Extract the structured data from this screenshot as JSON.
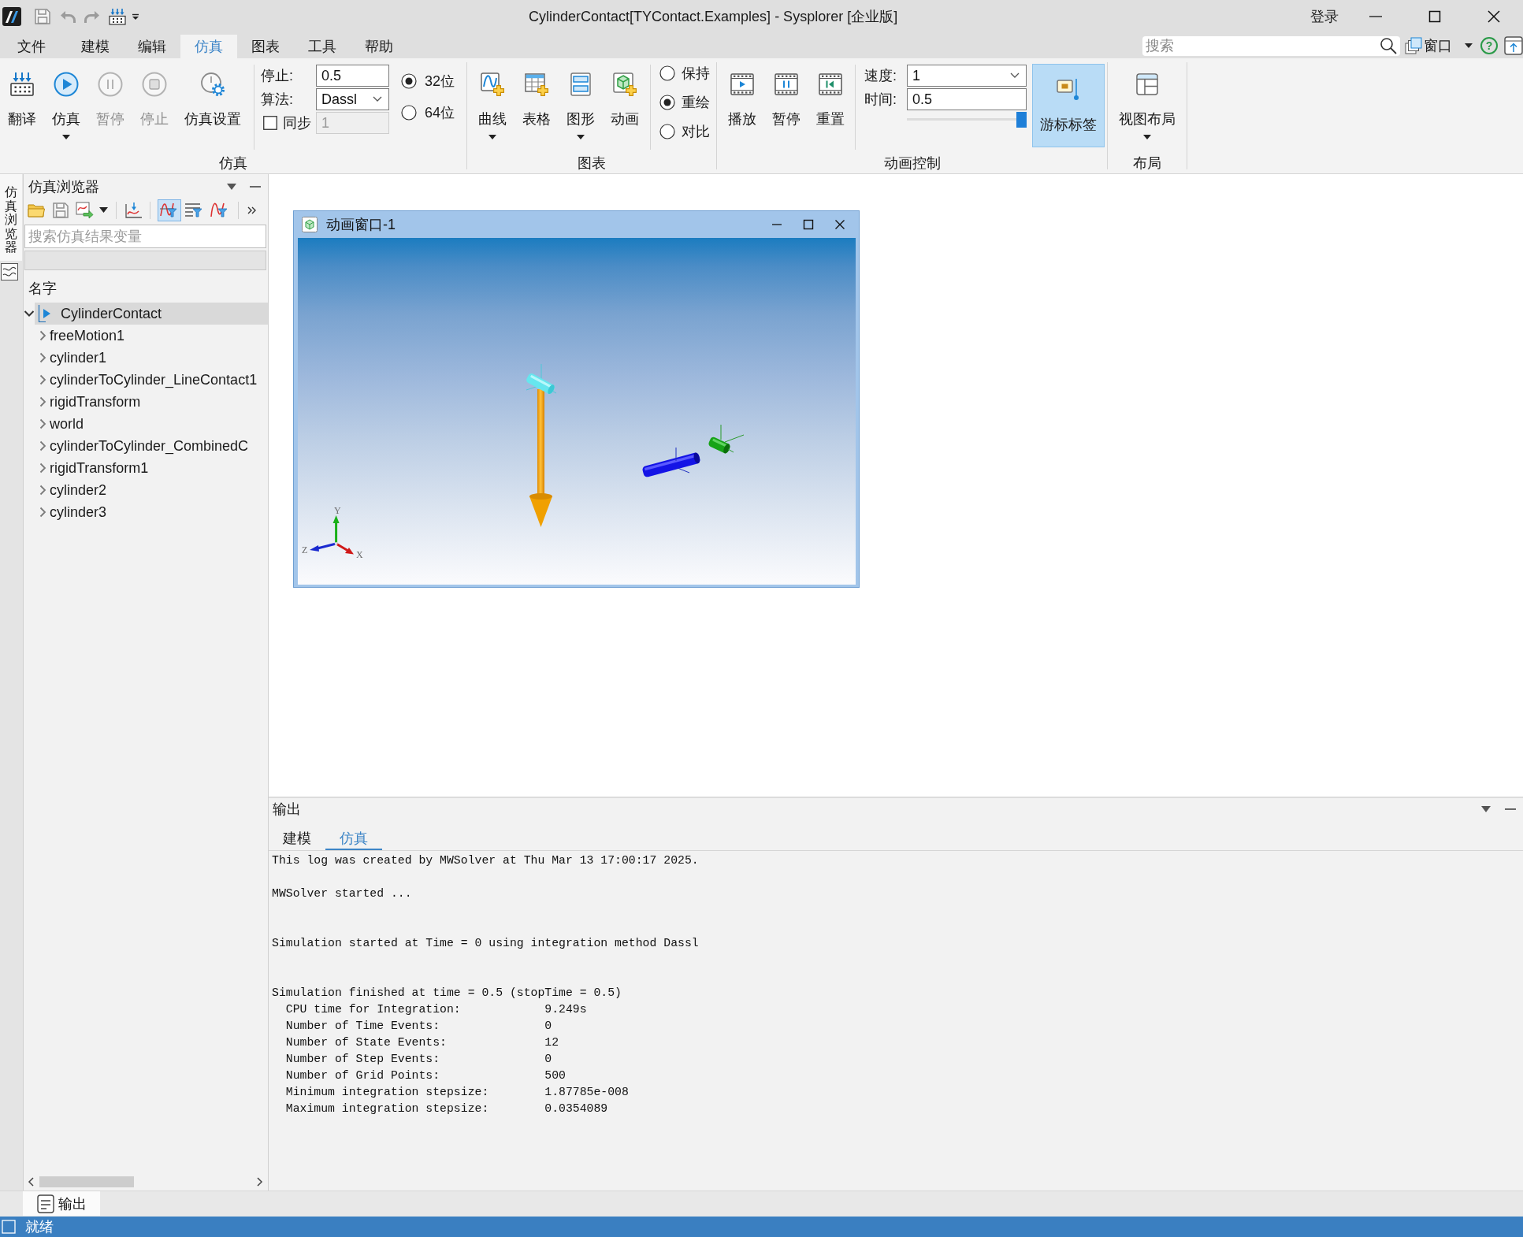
{
  "title_bar": {
    "title": "CylinderContact[TYContact.Examples] - Sysplorer [企业版]",
    "login": "登录"
  },
  "menu": [
    {
      "label": "文件",
      "selected": false
    },
    {
      "label": "建模",
      "selected": false
    },
    {
      "label": "编辑",
      "selected": false
    },
    {
      "label": "仿真",
      "selected": true
    },
    {
      "label": "图表",
      "selected": false
    },
    {
      "label": "工具",
      "selected": false
    },
    {
      "label": "帮助",
      "selected": false
    }
  ],
  "menu_right": {
    "search": {
      "placeholder": "搜索"
    },
    "window_button": "窗口",
    "help_button": "?"
  },
  "ribbon": {
    "simulation": {
      "label": "仿真",
      "buttons": [
        {
          "label": "翻译",
          "disabled": false,
          "dropdown": false
        },
        {
          "label": "仿真",
          "disabled": false,
          "dropdown": true
        },
        {
          "label": "暂停",
          "disabled": true,
          "dropdown": false
        },
        {
          "label": "停止",
          "disabled": true,
          "dropdown": false
        },
        {
          "label": "仿真设置",
          "disabled": false,
          "dropdown": false
        }
      ],
      "stop_time": {
        "label": "停止:",
        "value": "0.5"
      },
      "algorithm": {
        "label": "算法:",
        "value": "Dassl"
      },
      "sync": {
        "label": "同步",
        "checked": false,
        "value": "1",
        "disabled": true
      },
      "precision": [
        {
          "label": "32位",
          "selected": true
        },
        {
          "label": "64位",
          "selected": false
        }
      ]
    },
    "chart": {
      "label": "图表",
      "buttons": [
        {
          "label": "曲线",
          "dropdown": true
        },
        {
          "label": "表格",
          "dropdown": false
        },
        {
          "label": "图形",
          "dropdown": true
        },
        {
          "label": "动画",
          "dropdown": false
        }
      ],
      "modes": [
        {
          "label": "保持",
          "selected": false
        },
        {
          "label": "重绘",
          "selected": true
        },
        {
          "label": "对比",
          "selected": false
        }
      ]
    },
    "animation": {
      "label": "动画控制",
      "buttons": [
        {
          "label": "播放"
        },
        {
          "label": "暂停"
        },
        {
          "label": "重置"
        }
      ],
      "speed": {
        "label": "速度:",
        "value": "1"
      },
      "time": {
        "label": "时间:",
        "value": "0.5"
      },
      "time_slider": {
        "level": 1
      },
      "cursor_label": {
        "label": "游标标签",
        "on": true
      }
    },
    "layout": {
      "label": "布局",
      "buttons": [
        {
          "label": "视图布局",
          "dropdown": true
        }
      ]
    }
  },
  "side_strip": {
    "label": "仿真浏览器"
  },
  "browser": {
    "title": "仿真浏览器",
    "filters": [
      {
        "selected": true
      },
      {
        "selected": false
      },
      {
        "selected": false
      }
    ],
    "search": {
      "placeholder": "搜索仿真结果变量"
    },
    "column": "名字",
    "tree": [
      {
        "label": "CylinderContact",
        "expanded": true,
        "selected": true,
        "children": [
          {
            "label": "freeMotion1",
            "expanded": false,
            "selected": false
          },
          {
            "label": "cylinder1",
            "expanded": false,
            "selected": false
          },
          {
            "label": "cylinderToCylinder_LineContact1",
            "expanded": false,
            "selected": false
          },
          {
            "label": "rigidTransform",
            "expanded": false,
            "selected": false
          },
          {
            "label": "world",
            "expanded": false,
            "selected": false
          },
          {
            "label": "cylinderToCylinder_CombinedC",
            "expanded": false,
            "selected": false
          },
          {
            "label": "rigidTransform1",
            "expanded": false,
            "selected": false
          },
          {
            "label": "cylinder2",
            "expanded": false,
            "selected": false
          },
          {
            "label": "cylinder3",
            "expanded": false,
            "selected": false
          }
        ]
      }
    ]
  },
  "animation_window": {
    "title": "动画窗口-1",
    "axis_labels": {
      "x": "X",
      "y": "Y",
      "z": "Z"
    }
  },
  "output": {
    "title": "输出",
    "tabs": [
      {
        "label": "建模",
        "selected": false
      },
      {
        "label": "仿真",
        "selected": true
      }
    ],
    "log": [
      [
        "This log was created by MWSolver at Thu Mar 13 17:00:17 2025."
      ],
      [
        "MWSolver started ..."
      ],
      [
        "Simulation started at Time = 0 using integration method Dassl"
      ],
      [
        "Simulation finished at time = 0.5 (stopTime = 0.5)",
        "  CPU time for Integration:            9.249s",
        "  Number of Time Events:               0",
        "  Number of State Events:              12",
        "  Number of Step Events:               0",
        "  Number of Grid Points:               500",
        "  Minimum integration stepsize:        1.87785e-008",
        "  Maximum integration stepsize:        0.0354089"
      ]
    ]
  },
  "dock_tab": {
    "label": "输出"
  },
  "status_bar": {
    "text": "就绪"
  }
}
